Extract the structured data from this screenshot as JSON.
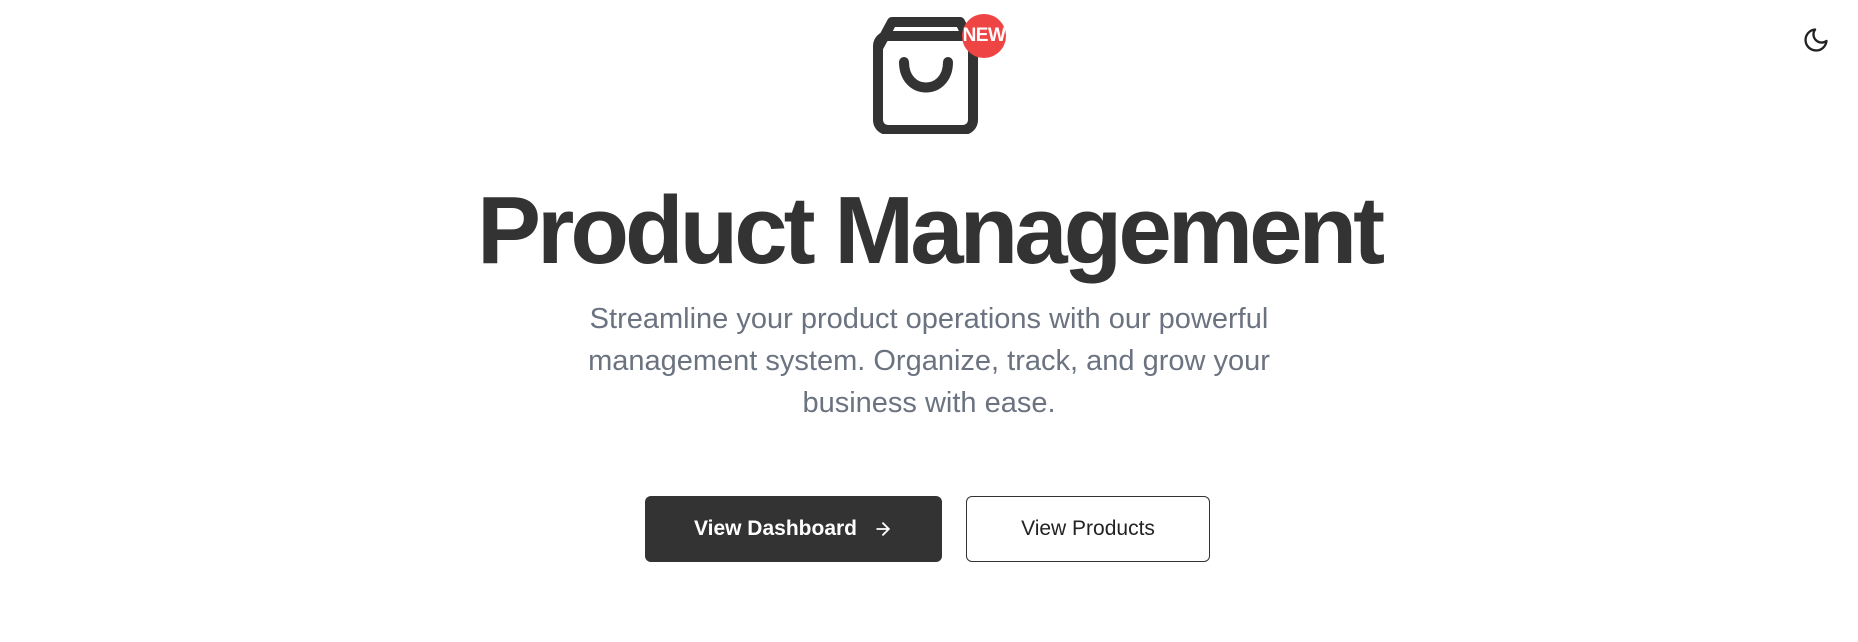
{
  "header": {
    "theme_toggle_icon": "moon-icon"
  },
  "hero": {
    "logo_icon": "shopping-bag-icon",
    "badge": "NEW",
    "title": "Product Management",
    "subtitle": "Streamline your product operations with our powerful management system. Organize, track, and grow your business with ease."
  },
  "actions": {
    "primary_label": "View Dashboard",
    "primary_icon": "arrow-right-icon",
    "secondary_label": "View Products"
  },
  "colors": {
    "background": "#ffffff",
    "primary": "#333333",
    "badge": "#ef4444",
    "subtitle": "#6b7280"
  }
}
